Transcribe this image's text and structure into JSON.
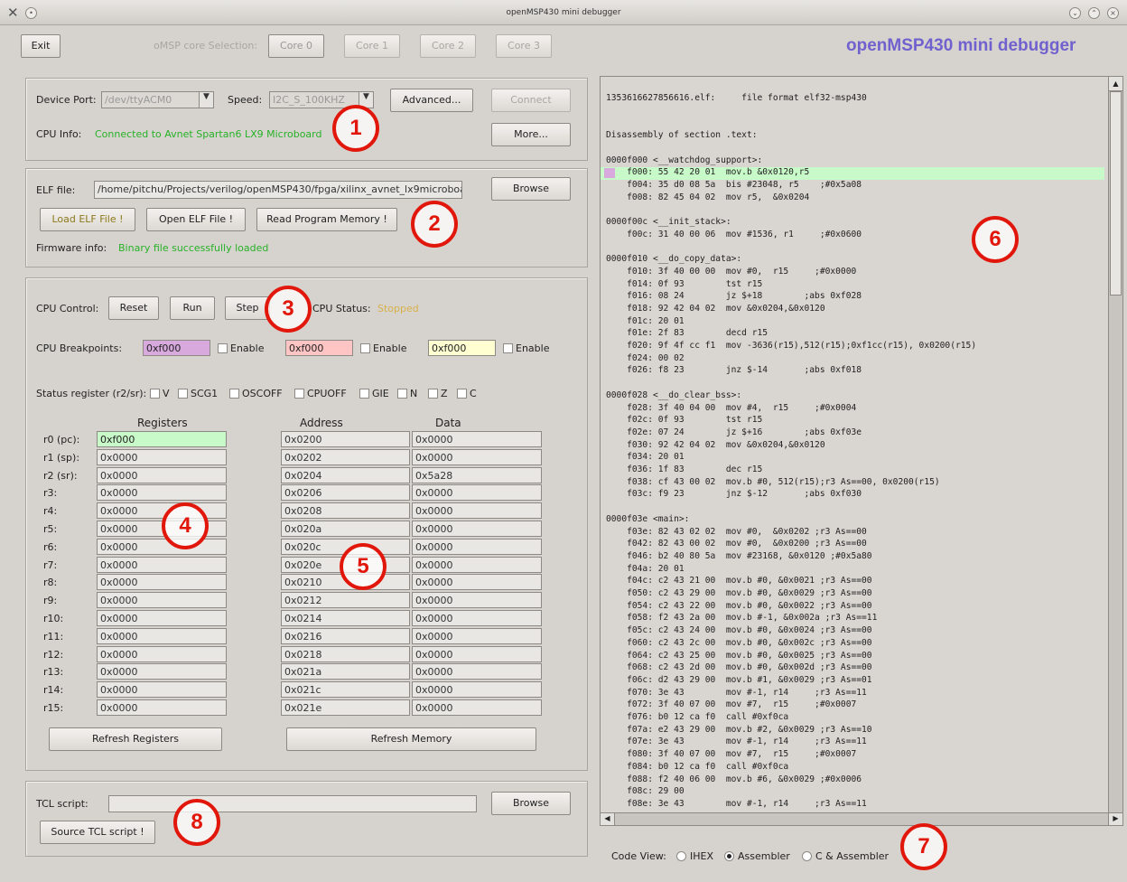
{
  "window": {
    "title": "openMSP430 mini debugger"
  },
  "top": {
    "exit": "Exit",
    "core_sel_label": "oMSP core Selection:",
    "cores": [
      "Core 0",
      "Core 1",
      "Core 2",
      "Core 3"
    ],
    "app_title": "openMSP430 mini debugger"
  },
  "conn": {
    "device_port_label": "Device Port:",
    "device_port": "/dev/ttyACM0",
    "speed_label": "Speed:",
    "speed": "I2C_S_100KHZ",
    "advanced": "Advanced...",
    "connect": "Connect",
    "cpu_info_label": "CPU Info:",
    "cpu_info": "Connected to Avnet Spartan6 LX9 Microboard",
    "more": "More..."
  },
  "elf": {
    "label": "ELF file:",
    "path": "/home/pitchu/Projects/verilog/openMSP430/fpga/xilinx_avnet_lx9microboard/",
    "browse": "Browse",
    "load": "Load ELF File !",
    "open": "Open ELF File !",
    "read": "Read Program Memory !",
    "fw_label": "Firmware info:",
    "fw_info": "Binary file successfully loaded"
  },
  "cpu": {
    "control_label": "CPU Control:",
    "reset": "Reset",
    "run": "Run",
    "step": "Step",
    "status_label": "CPU Status:",
    "status": "Stopped",
    "bp_label": "CPU Breakpoints:",
    "breakpoints": [
      {
        "value": "0xf000",
        "enable": "Enable",
        "color": "#d8a9dd"
      },
      {
        "value": "0xf000",
        "enable": "Enable",
        "color": "#ffc4c4"
      },
      {
        "value": "0xf000",
        "enable": "Enable",
        "color": "#ffffd2"
      }
    ],
    "sr_label": "Status register (r2/sr):",
    "sr_flags": [
      "V",
      "SCG1",
      "OSCOFF",
      "CPUOFF",
      "GIE",
      "N",
      "Z",
      "C"
    ]
  },
  "regs": {
    "header": "Registers",
    "names": [
      "r0 (pc):",
      "r1 (sp):",
      "r2 (sr):",
      "r3:",
      "r4:",
      "r5:",
      "r6:",
      "r7:",
      "r8:",
      "r9:",
      "r10:",
      "r11:",
      "r12:",
      "r13:",
      "r14:",
      "r15:"
    ],
    "values": [
      "0xf000",
      "0x0000",
      "0x0000",
      "0x0000",
      "0x0000",
      "0x0000",
      "0x0000",
      "0x0000",
      "0x0000",
      "0x0000",
      "0x0000",
      "0x0000",
      "0x0000",
      "0x0000",
      "0x0000",
      "0x0000"
    ],
    "refresh": "Refresh Registers"
  },
  "mem": {
    "addr_header": "Address",
    "data_header": "Data",
    "addresses": [
      "0x0200",
      "0x0202",
      "0x0204",
      "0x0206",
      "0x0208",
      "0x020a",
      "0x020c",
      "0x020e",
      "0x0210",
      "0x0212",
      "0x0214",
      "0x0216",
      "0x0218",
      "0x021a",
      "0x021c",
      "0x021e"
    ],
    "data": [
      "0x0000",
      "0x0000",
      "0x5a28",
      "0x0000",
      "0x0000",
      "0x0000",
      "0x0000",
      "0x0000",
      "0x0000",
      "0x0000",
      "0x0000",
      "0x0000",
      "0x0000",
      "0x0000",
      "0x0000",
      "0x0000"
    ],
    "refresh": "Refresh Memory"
  },
  "tcl": {
    "label": "TCL script:",
    "value": "",
    "browse": "Browse",
    "source": "Source TCL script !"
  },
  "code": {
    "lines": [
      "1353616627856616.elf:     file format elf32-msp430",
      "",
      "",
      "Disassembly of section .text:",
      "",
      "0000f000 <__watchdog_support>:",
      "    f000: 55 42 20 01  mov.b &0x0120,r5",
      "    f004: 35 d0 08 5a  bis #23048, r5    ;#0x5a08",
      "    f008: 82 45 04 02  mov r5,  &0x0204",
      "",
      "0000f00c <__init_stack>:",
      "    f00c: 31 40 00 06  mov #1536, r1     ;#0x0600",
      "",
      "0000f010 <__do_copy_data>:",
      "    f010: 3f 40 00 00  mov #0,  r15     ;#0x0000",
      "    f014: 0f 93        tst r15",
      "    f016: 08 24        jz $+18        ;abs 0xf028",
      "    f018: 92 42 04 02  mov &0x0204,&0x0120",
      "    f01c: 20 01",
      "    f01e: 2f 83        decd r15",
      "    f020: 9f 4f cc f1  mov -3636(r15),512(r15);0xf1cc(r15), 0x0200(r15)",
      "    f024: 00 02",
      "    f026: f8 23        jnz $-14       ;abs 0xf018",
      "",
      "0000f028 <__do_clear_bss>:",
      "    f028: 3f 40 04 00  mov #4,  r15     ;#0x0004",
      "    f02c: 0f 93        tst r15",
      "    f02e: 07 24        jz $+16        ;abs 0xf03e",
      "    f030: 92 42 04 02  mov &0x0204,&0x0120",
      "    f034: 20 01",
      "    f036: 1f 83        dec r15",
      "    f038: cf 43 00 02  mov.b #0, 512(r15);r3 As==00, 0x0200(r15)",
      "    f03c: f9 23        jnz $-12       ;abs 0xf030",
      "",
      "0000f03e <main>:",
      "    f03e: 82 43 02 02  mov #0,  &0x0202 ;r3 As==00",
      "    f042: 82 43 00 02  mov #0,  &0x0200 ;r3 As==00",
      "    f046: b2 40 80 5a  mov #23168, &0x0120 ;#0x5a80",
      "    f04a: 20 01",
      "    f04c: c2 43 21 00  mov.b #0, &0x0021 ;r3 As==00",
      "    f050: c2 43 29 00  mov.b #0, &0x0029 ;r3 As==00",
      "    f054: c2 43 22 00  mov.b #0, &0x0022 ;r3 As==00",
      "    f058: f2 43 2a 00  mov.b #-1, &0x002a ;r3 As==11",
      "    f05c: c2 43 24 00  mov.b #0, &0x0024 ;r3 As==00",
      "    f060: c2 43 2c 00  mov.b #0, &0x002c ;r3 As==00",
      "    f064: c2 43 25 00  mov.b #0, &0x0025 ;r3 As==00",
      "    f068: c2 43 2d 00  mov.b #0, &0x002d ;r3 As==00",
      "    f06c: d2 43 29 00  mov.b #1, &0x0029 ;r3 As==01",
      "    f070: 3e 43        mov #-1, r14     ;r3 As==11",
      "    f072: 3f 40 07 00  mov #7,  r15     ;#0x0007",
      "    f076: b0 12 ca f0  call #0xf0ca",
      "    f07a: e2 43 29 00  mov.b #2, &0x0029 ;r3 As==10",
      "    f07e: 3e 43        mov #-1, r14     ;r3 As==11",
      "    f080: 3f 40 07 00  mov #7,  r15     ;#0x0007",
      "    f084: b0 12 ca f0  call #0xf0ca",
      "    f088: f2 40 06 00  mov.b #6, &0x0029 ;#0x0006",
      "    f08c: 29 00",
      "    f08e: 3e 43        mov #-1, r14     ;r3 As==11"
    ],
    "highlight_line": 6
  },
  "view": {
    "label": "Code View:",
    "options": [
      "IHEX",
      "Assembler",
      "C & Assembler"
    ],
    "selected": "Assembler"
  },
  "annotations": [
    "1",
    "2",
    "3",
    "4",
    "5",
    "6",
    "7",
    "8"
  ]
}
